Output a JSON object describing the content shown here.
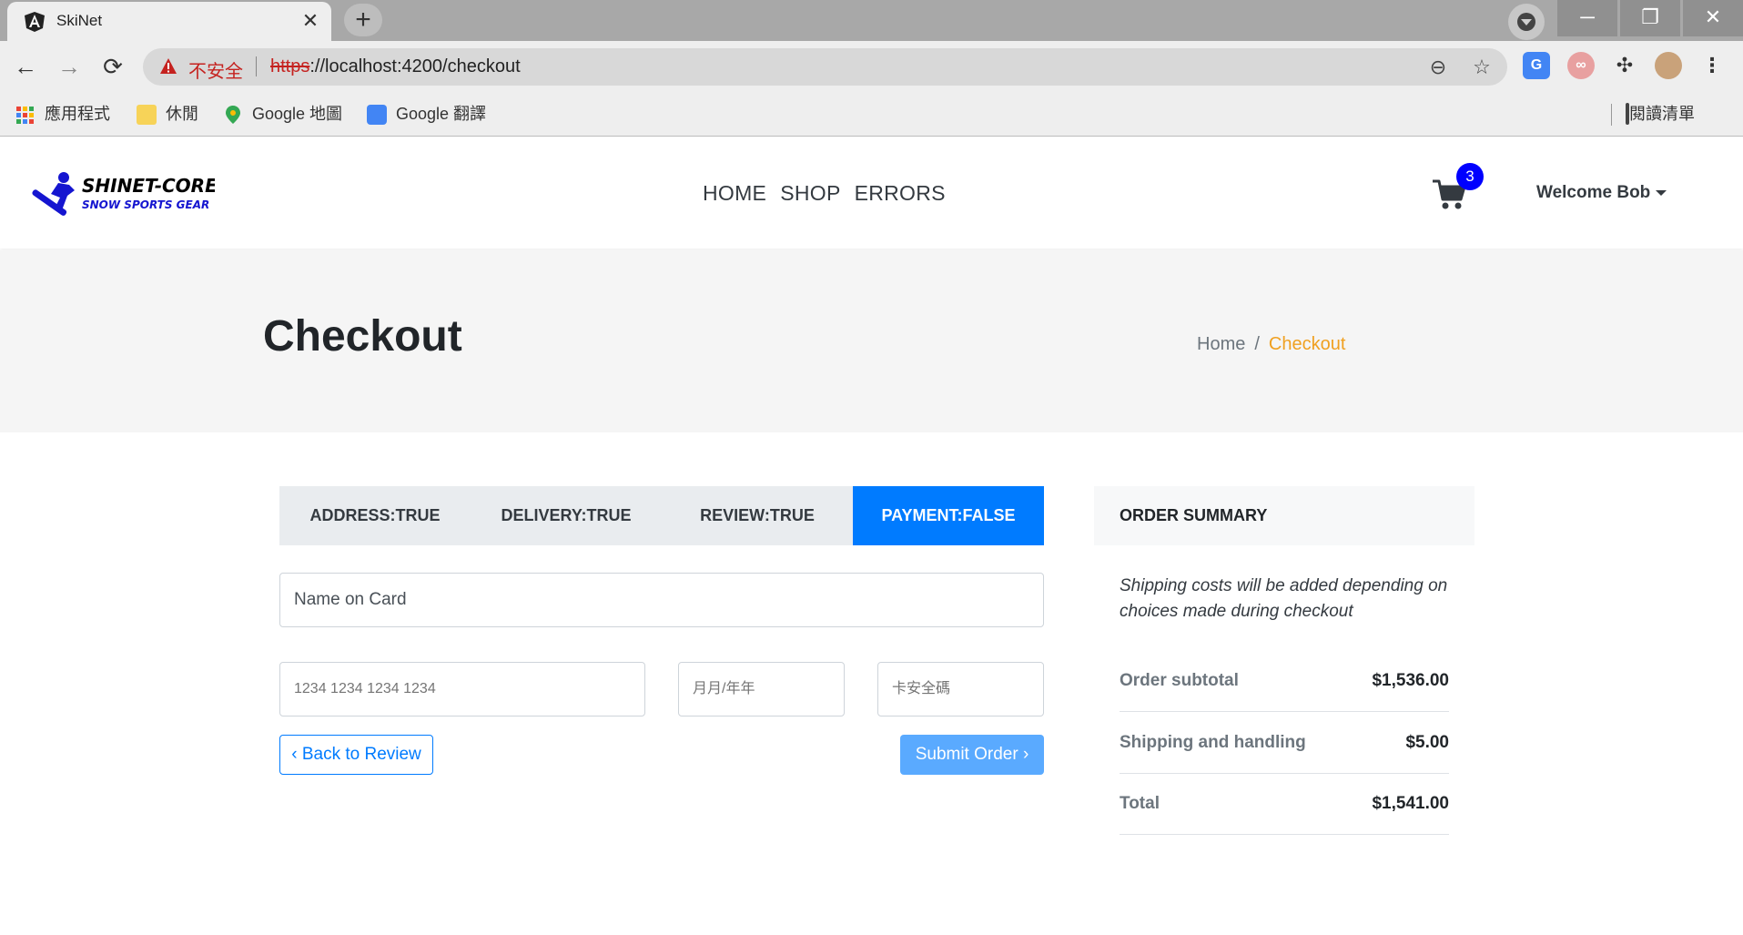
{
  "browser": {
    "tab_title": "SkiNet",
    "tab_close": "✕",
    "new_tab": "+",
    "insecure_label": "不安全",
    "url_scheme": "https",
    "url_rest": "://localhost:4200/checkout",
    "window_buttons": {
      "minimize": "─",
      "restore": "❐",
      "close": "✕"
    }
  },
  "bookmarks": {
    "apps": "應用程式",
    "leisure": "休閒",
    "maps": "Google 地圖",
    "translate": "Google 翻譯",
    "reading_list": "閱讀清單"
  },
  "site": {
    "logo_line1": "SHINET-CORE",
    "logo_line2": "SNOW SPORTS GEAR",
    "nav": {
      "home": "HOME",
      "shop": "SHOP",
      "errors": "ERRORS"
    },
    "cart_count": "3",
    "welcome": "Welcome Bob"
  },
  "header": {
    "title": "Checkout",
    "breadcrumb_home": "Home",
    "breadcrumb_sep": "/",
    "breadcrumb_current": "Checkout"
  },
  "stepper": {
    "steps": [
      "ADDRESS:TRUE",
      "DELIVERY:TRUE",
      "REVIEW:TRUE",
      "PAYMENT:FALSE"
    ]
  },
  "payment": {
    "name_on_card_placeholder": "Name on Card",
    "card_number_placeholder": "1234 1234 1234 1234",
    "expiry_placeholder": "月月/年年",
    "cvc_placeholder": "卡安全碼",
    "back_button": "‹ Back to Review",
    "submit_button": "Submit Order ›"
  },
  "summary": {
    "title": "ORDER SUMMARY",
    "note": "Shipping costs will be added depending on choices made during checkout",
    "rows": [
      {
        "label": "Order subtotal",
        "value": "$1,536.00"
      },
      {
        "label": "Shipping and handling",
        "value": "$5.00"
      },
      {
        "label": "Total",
        "value": "$1,541.00"
      }
    ]
  },
  "colors": {
    "primary": "#007bff",
    "accent_breadcrumb": "#f0a020",
    "cart_badge": "#0000ff",
    "insecure_red": "#c5221f"
  }
}
